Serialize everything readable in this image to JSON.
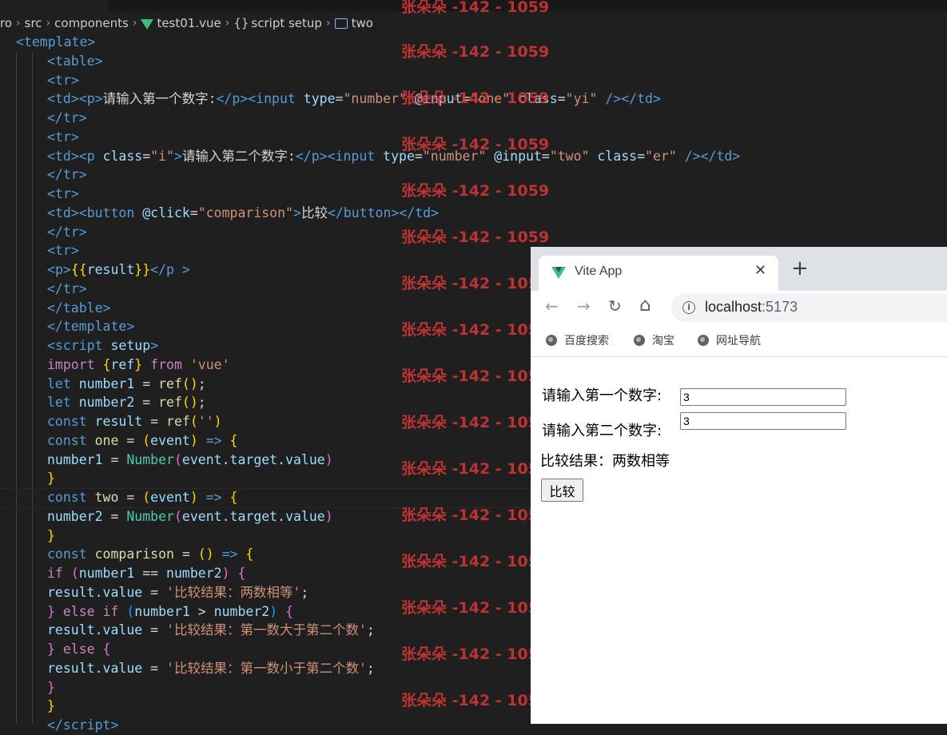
{
  "breadcrumb": {
    "items": [
      "ro",
      "src",
      "components",
      "test01.vue",
      "script setup",
      "two"
    ],
    "braces_glyph": "{}",
    "file_icon": "vue-logo-icon",
    "scope_icon": "braces-icon",
    "symbol_icon": "variable-icon"
  },
  "code": {
    "lines": [
      [
        [
          "<",
          "tag"
        ],
        [
          "template",
          "tag"
        ],
        [
          ">",
          "tag"
        ]
      ],
      [
        [
          "<",
          "tag"
        ],
        [
          "table",
          "tag"
        ],
        [
          ">",
          "tag"
        ]
      ],
      [
        [
          "<",
          "tag"
        ],
        [
          "tr",
          "tag"
        ],
        [
          ">",
          "tag"
        ]
      ],
      [
        [
          "<",
          "tag"
        ],
        [
          "td",
          "tag"
        ],
        [
          "><",
          "tag"
        ],
        [
          "p",
          "tag"
        ],
        [
          ">",
          "tag"
        ],
        [
          "请输入第一个数字:",
          "txt"
        ],
        [
          "</",
          "tag"
        ],
        [
          "p",
          "tag"
        ],
        [
          "><",
          "tag"
        ],
        [
          "input ",
          "tag"
        ],
        [
          "type",
          "attr"
        ],
        [
          "=",
          "txt"
        ],
        [
          "\"number\"",
          "str"
        ],
        [
          " @input",
          "attr"
        ],
        [
          "=",
          "txt"
        ],
        [
          "\"one\"",
          "str"
        ],
        [
          " class",
          "attr"
        ],
        [
          "=",
          "txt"
        ],
        [
          "\"yi\"",
          "str"
        ],
        [
          " /></",
          "tag"
        ],
        [
          "td",
          "tag"
        ],
        [
          ">",
          "tag"
        ]
      ],
      [
        [
          "</",
          "tag"
        ],
        [
          "tr",
          "tag"
        ],
        [
          ">",
          "tag"
        ]
      ],
      [
        [
          "<",
          "tag"
        ],
        [
          "tr",
          "tag"
        ],
        [
          ">",
          "tag"
        ]
      ],
      [
        [
          "<",
          "tag"
        ],
        [
          "td",
          "tag"
        ],
        [
          "><",
          "tag"
        ],
        [
          "p ",
          "tag"
        ],
        [
          "class",
          "attr"
        ],
        [
          "=",
          "txt"
        ],
        [
          "\"i\"",
          "str"
        ],
        [
          ">",
          "tag"
        ],
        [
          "请输入第二个数字:",
          "txt"
        ],
        [
          "</",
          "tag"
        ],
        [
          "p",
          "tag"
        ],
        [
          "><",
          "tag"
        ],
        [
          "input ",
          "tag"
        ],
        [
          "type",
          "attr"
        ],
        [
          "=",
          "txt"
        ],
        [
          "\"number\"",
          "str"
        ],
        [
          " @input",
          "attr"
        ],
        [
          "=",
          "txt"
        ],
        [
          "\"two\"",
          "str"
        ],
        [
          " class",
          "attr"
        ],
        [
          "=",
          "txt"
        ],
        [
          "\"er\"",
          "str"
        ],
        [
          " /></",
          "tag"
        ],
        [
          "td",
          "tag"
        ],
        [
          ">",
          "tag"
        ]
      ],
      [
        [
          "</",
          "tag"
        ],
        [
          "tr",
          "tag"
        ],
        [
          ">",
          "tag"
        ]
      ],
      [
        [
          "<",
          "tag"
        ],
        [
          "tr",
          "tag"
        ],
        [
          ">",
          "tag"
        ]
      ],
      [
        [
          "<",
          "tag"
        ],
        [
          "td",
          "tag"
        ],
        [
          "><",
          "tag"
        ],
        [
          "button ",
          "tag"
        ],
        [
          "@click",
          "attr"
        ],
        [
          "=",
          "txt"
        ],
        [
          "\"comparison\"",
          "str"
        ],
        [
          ">",
          "tag"
        ],
        [
          "比较",
          "txt"
        ],
        [
          "</",
          "tag"
        ],
        [
          "button",
          "tag"
        ],
        [
          "></",
          "tag"
        ],
        [
          "td",
          "tag"
        ],
        [
          ">",
          "tag"
        ]
      ],
      [
        [
          "</",
          "tag"
        ],
        [
          "tr",
          "tag"
        ],
        [
          ">",
          "tag"
        ]
      ],
      [
        [
          "<",
          "tag"
        ],
        [
          "tr",
          "tag"
        ],
        [
          ">",
          "tag"
        ]
      ],
      [
        [
          "<",
          "tag"
        ],
        [
          "p",
          "tag"
        ],
        [
          ">",
          "tag"
        ],
        [
          "{{",
          "b1"
        ],
        [
          "result",
          "var"
        ],
        [
          "}}",
          "b1"
        ],
        [
          "</",
          "tag"
        ],
        [
          "p ",
          "tag"
        ],
        [
          ">",
          "tag"
        ]
      ],
      [
        [
          "</",
          "tag"
        ],
        [
          "tr",
          "tag"
        ],
        [
          ">",
          "tag"
        ]
      ],
      [
        [
          "</",
          "tag"
        ],
        [
          "table",
          "tag"
        ],
        [
          ">",
          "tag"
        ]
      ],
      [
        [
          "</",
          "tag"
        ],
        [
          "template",
          "tag"
        ],
        [
          ">",
          "tag"
        ]
      ],
      [
        [
          "<",
          "tag"
        ],
        [
          "script ",
          "tag"
        ],
        [
          "setup",
          "attr"
        ],
        [
          ">",
          "tag"
        ]
      ],
      [
        [
          "import ",
          "ctl"
        ],
        [
          "{",
          "b1"
        ],
        [
          "ref",
          "var"
        ],
        [
          "}",
          "b1"
        ],
        [
          " from ",
          "ctl"
        ],
        [
          "'vue'",
          "str"
        ]
      ],
      [
        [
          "let ",
          "kw"
        ],
        [
          "number1",
          "var"
        ],
        [
          " = ",
          "txt"
        ],
        [
          "ref",
          "fn"
        ],
        [
          "()",
          "b1"
        ],
        [
          ";",
          "txt"
        ]
      ],
      [
        [
          "let ",
          "kw"
        ],
        [
          "number2",
          "var"
        ],
        [
          " = ",
          "txt"
        ],
        [
          "ref",
          "fn"
        ],
        [
          "()",
          "b1"
        ],
        [
          ";",
          "txt"
        ]
      ],
      [
        [
          "const ",
          "kw"
        ],
        [
          "result",
          "var"
        ],
        [
          " = ",
          "txt"
        ],
        [
          "ref",
          "fn"
        ],
        [
          "(",
          "b1"
        ],
        [
          "''",
          "str"
        ],
        [
          ")",
          "b1"
        ]
      ],
      [
        [
          "const ",
          "kw"
        ],
        [
          "one",
          "fn"
        ],
        [
          " = ",
          "txt"
        ],
        [
          "(",
          "b1"
        ],
        [
          "event",
          "var"
        ],
        [
          ")",
          "b1"
        ],
        [
          " => ",
          "kw"
        ],
        [
          "{",
          "b1"
        ]
      ],
      [
        [
          "number1",
          "var"
        ],
        [
          " = ",
          "txt"
        ],
        [
          "Number",
          "cls"
        ],
        [
          "(",
          "b2"
        ],
        [
          "event",
          "var"
        ],
        [
          ".",
          "txt"
        ],
        [
          "target",
          "var"
        ],
        [
          ".",
          "txt"
        ],
        [
          "value",
          "var"
        ],
        [
          ")",
          "b2"
        ]
      ],
      [
        [
          "}",
          "b1"
        ]
      ],
      [
        [
          "const ",
          "kw"
        ],
        [
          "two",
          "fn"
        ],
        [
          " = ",
          "txt"
        ],
        [
          "(",
          "b1"
        ],
        [
          "event",
          "var"
        ],
        [
          ")",
          "b1"
        ],
        [
          " => ",
          "kw"
        ],
        [
          "{",
          "b1"
        ]
      ],
      [
        [
          "number2",
          "var"
        ],
        [
          " = ",
          "txt"
        ],
        [
          "Number",
          "cls"
        ],
        [
          "(",
          "b2"
        ],
        [
          "event",
          "var"
        ],
        [
          ".",
          "txt"
        ],
        [
          "target",
          "var"
        ],
        [
          ".",
          "txt"
        ],
        [
          "value",
          "var"
        ],
        [
          ")",
          "b2"
        ]
      ],
      [
        [
          "}",
          "b1"
        ]
      ],
      [
        [
          "const ",
          "kw"
        ],
        [
          "comparison",
          "fn"
        ],
        [
          " = ",
          "txt"
        ],
        [
          "()",
          "b1"
        ],
        [
          " => ",
          "kw"
        ],
        [
          "{",
          "b1"
        ]
      ],
      [
        [
          "if ",
          "ctl"
        ],
        [
          "(",
          "b2"
        ],
        [
          "number1",
          "var"
        ],
        [
          " == ",
          "txt"
        ],
        [
          "number2",
          "var"
        ],
        [
          ")",
          "b2"
        ],
        [
          " {",
          "b2"
        ]
      ],
      [
        [
          "result",
          "var"
        ],
        [
          ".",
          "txt"
        ],
        [
          "value",
          "var"
        ],
        [
          " = ",
          "txt"
        ],
        [
          "'比较结果：两数相等'",
          "str"
        ],
        [
          ";",
          "txt"
        ]
      ],
      [
        [
          "} ",
          "b2"
        ],
        [
          "else ",
          "ctl"
        ],
        [
          "if ",
          "ctl"
        ],
        [
          "(",
          "b3"
        ],
        [
          "number1",
          "var"
        ],
        [
          " > ",
          "txt"
        ],
        [
          "number2",
          "var"
        ],
        [
          ")",
          "b3"
        ],
        [
          " {",
          "b2"
        ]
      ],
      [
        [
          "result",
          "var"
        ],
        [
          ".",
          "txt"
        ],
        [
          "value",
          "var"
        ],
        [
          " = ",
          "txt"
        ],
        [
          "'比较结果：第一数大于第二个数'",
          "str"
        ],
        [
          ";",
          "txt"
        ]
      ],
      [
        [
          "} ",
          "b2"
        ],
        [
          "else ",
          "ctl"
        ],
        [
          "{",
          "b2"
        ]
      ],
      [
        [
          "result",
          "var"
        ],
        [
          ".",
          "txt"
        ],
        [
          "value",
          "var"
        ],
        [
          " = ",
          "txt"
        ],
        [
          "'比较结果：第一数小于第二个数'",
          "str"
        ],
        [
          ";",
          "txt"
        ]
      ],
      [
        [
          "}",
          "b2"
        ]
      ],
      [
        [
          "}",
          "b1"
        ]
      ],
      [
        [
          "</",
          "tag"
        ],
        [
          "script",
          "tag"
        ],
        [
          ">",
          "tag"
        ]
      ]
    ]
  },
  "watermark": {
    "text": "张朵朵 -142 - 1059",
    "count": 16
  },
  "browser": {
    "tab_title": "Vite App",
    "tab_icon": "vite-vue-logo-icon",
    "close_glyph": "✕",
    "new_tab_glyph": "+",
    "nav": {
      "back": "←",
      "forward": "→",
      "reload": "↻",
      "home": "⌂"
    },
    "address": {
      "host": "localhost",
      "port": ":5173",
      "info_glyph": "i"
    },
    "bookmarks": [
      "百度搜索",
      "淘宝",
      "网址导航"
    ],
    "page": {
      "label1": "请输入第一个数字:",
      "value1": "3",
      "label2": "请输入第二个数字:",
      "value2": "3",
      "result": "比较结果：两数相等",
      "button": "比较"
    }
  }
}
